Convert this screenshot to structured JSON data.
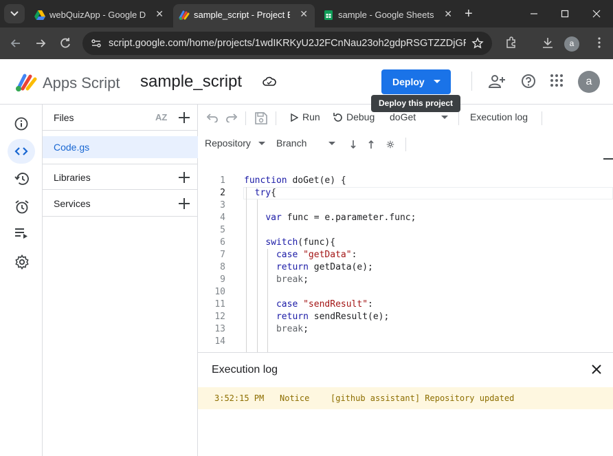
{
  "browser": {
    "tabs": [
      {
        "title": "webQuizApp - Google Drive",
        "icon": "google-drive-icon",
        "active": false
      },
      {
        "title": "sample_script - Project Editor",
        "icon": "apps-script-icon",
        "active": true
      },
      {
        "title": "sample - Google Sheets",
        "icon": "google-sheets-icon",
        "active": false
      }
    ],
    "url": "script.google.com/home/projects/1wdIKRKyU2J2FCnNau23oh2gdpRSGTZZDjGRD...",
    "profile_initial": "a"
  },
  "header": {
    "brand": "Apps Script",
    "project_name": "sample_script",
    "deploy_label": "Deploy",
    "deploy_tooltip": "Deploy this project",
    "avatar_initial": "a"
  },
  "files_panel": {
    "files_title": "Files",
    "sort_label": "AZ",
    "files": [
      "Code.gs"
    ],
    "libraries_title": "Libraries",
    "services_title": "Services"
  },
  "editor_toolbar": {
    "run_label": "Run",
    "debug_label": "Debug",
    "function_select": "doGet",
    "execution_log_label": "Execution log",
    "repository_label": "Repository",
    "branch_label": "Branch"
  },
  "code": {
    "current_line": 2,
    "lines": [
      {
        "n": "1",
        "text": "function doGet(e) {"
      },
      {
        "n": "2",
        "text": "  try{"
      },
      {
        "n": "3",
        "text": ""
      },
      {
        "n": "4",
        "text": "    var func = e.parameter.func;"
      },
      {
        "n": "5",
        "text": ""
      },
      {
        "n": "6",
        "text": "    switch(func){"
      },
      {
        "n": "7",
        "text": "      case \"getData\":"
      },
      {
        "n": "8",
        "text": "      return getData(e);"
      },
      {
        "n": "9",
        "text": "      break;"
      },
      {
        "n": "10",
        "text": ""
      },
      {
        "n": "11",
        "text": "      case \"sendResult\":"
      },
      {
        "n": "12",
        "text": "      return sendResult(e);"
      },
      {
        "n": "13",
        "text": "      break;"
      },
      {
        "n": "14",
        "text": ""
      }
    ]
  },
  "execution_log": {
    "title": "Execution log",
    "entries": [
      {
        "time": "3:52:15 PM",
        "level": "Notice",
        "message": "[github assistant] Repository updated"
      }
    ]
  },
  "colors": {
    "accent": "#1a73e8",
    "keyword": "#1a1aa6",
    "string": "#a31515",
    "notice_bg": "#fef7e0"
  }
}
